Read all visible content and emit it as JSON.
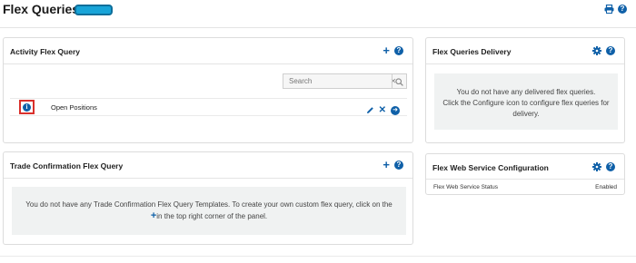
{
  "page": {
    "title": "Flex Queries",
    "accent_color": "#0f60a8",
    "badge_color": "#18a4d8",
    "icons": [
      "print-icon",
      "help-icon"
    ]
  },
  "activity_panel": {
    "title": "Activity Flex Query",
    "icons": [
      "plus-icon",
      "help-icon"
    ],
    "search": {
      "placeholder": "Search",
      "value": ""
    },
    "queries": [
      {
        "name": "Open Positions",
        "icons": [
          "info-icon",
          "edit-pencil-icon",
          "delete-x-icon",
          "run-arrow-icon"
        ]
      }
    ]
  },
  "trade_panel": {
    "title": "Trade Confirmation Flex Query",
    "icons": [
      "plus-icon",
      "help-icon"
    ],
    "empty_message_before": "You do not have any Trade Confirmation Flex Query Templates. To create your own custom flex query, click on the",
    "empty_message_after": "in the top right corner of the panel."
  },
  "delivery_panel": {
    "title": "Flex Queries Delivery",
    "icons": [
      "gear-icon",
      "help-icon"
    ],
    "empty_line1": "You do not have any delivered flex queries.",
    "empty_line2": "Click the Configure icon to configure flex queries for delivery."
  },
  "webservice_panel": {
    "title": "Flex Web Service Configuration",
    "icons": [
      "gear-icon",
      "help-icon"
    ],
    "status_label": "Flex Web Service Status",
    "status_value": "Enabled"
  }
}
